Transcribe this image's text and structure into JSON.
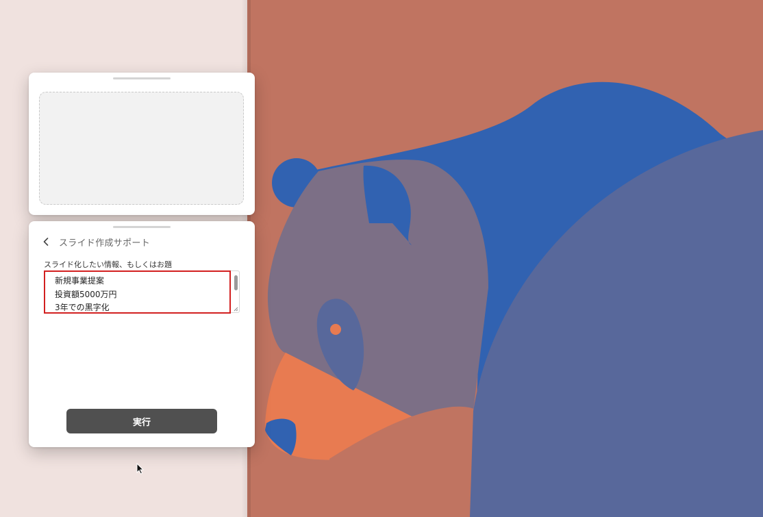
{
  "panel": {
    "header": {
      "back_icon": "chevron-left-icon",
      "title": "スライド作成サポート"
    },
    "input": {
      "label": "スライド化したい情報、もしくはお題",
      "lines": [
        "新規事業提案",
        "投資額5000万円",
        "3年での黒字化"
      ]
    },
    "run_button": {
      "label": "実行"
    }
  },
  "colors": {
    "page_background": "#f0e2df",
    "art_background": "#c07461",
    "bear_blue": "#3162b1",
    "bear_slate": "#58689b",
    "bear_mauve": "#7c6f86",
    "bear_orange": "#e87b51",
    "focus_outline": "#d21f1f",
    "button": "#505050"
  }
}
